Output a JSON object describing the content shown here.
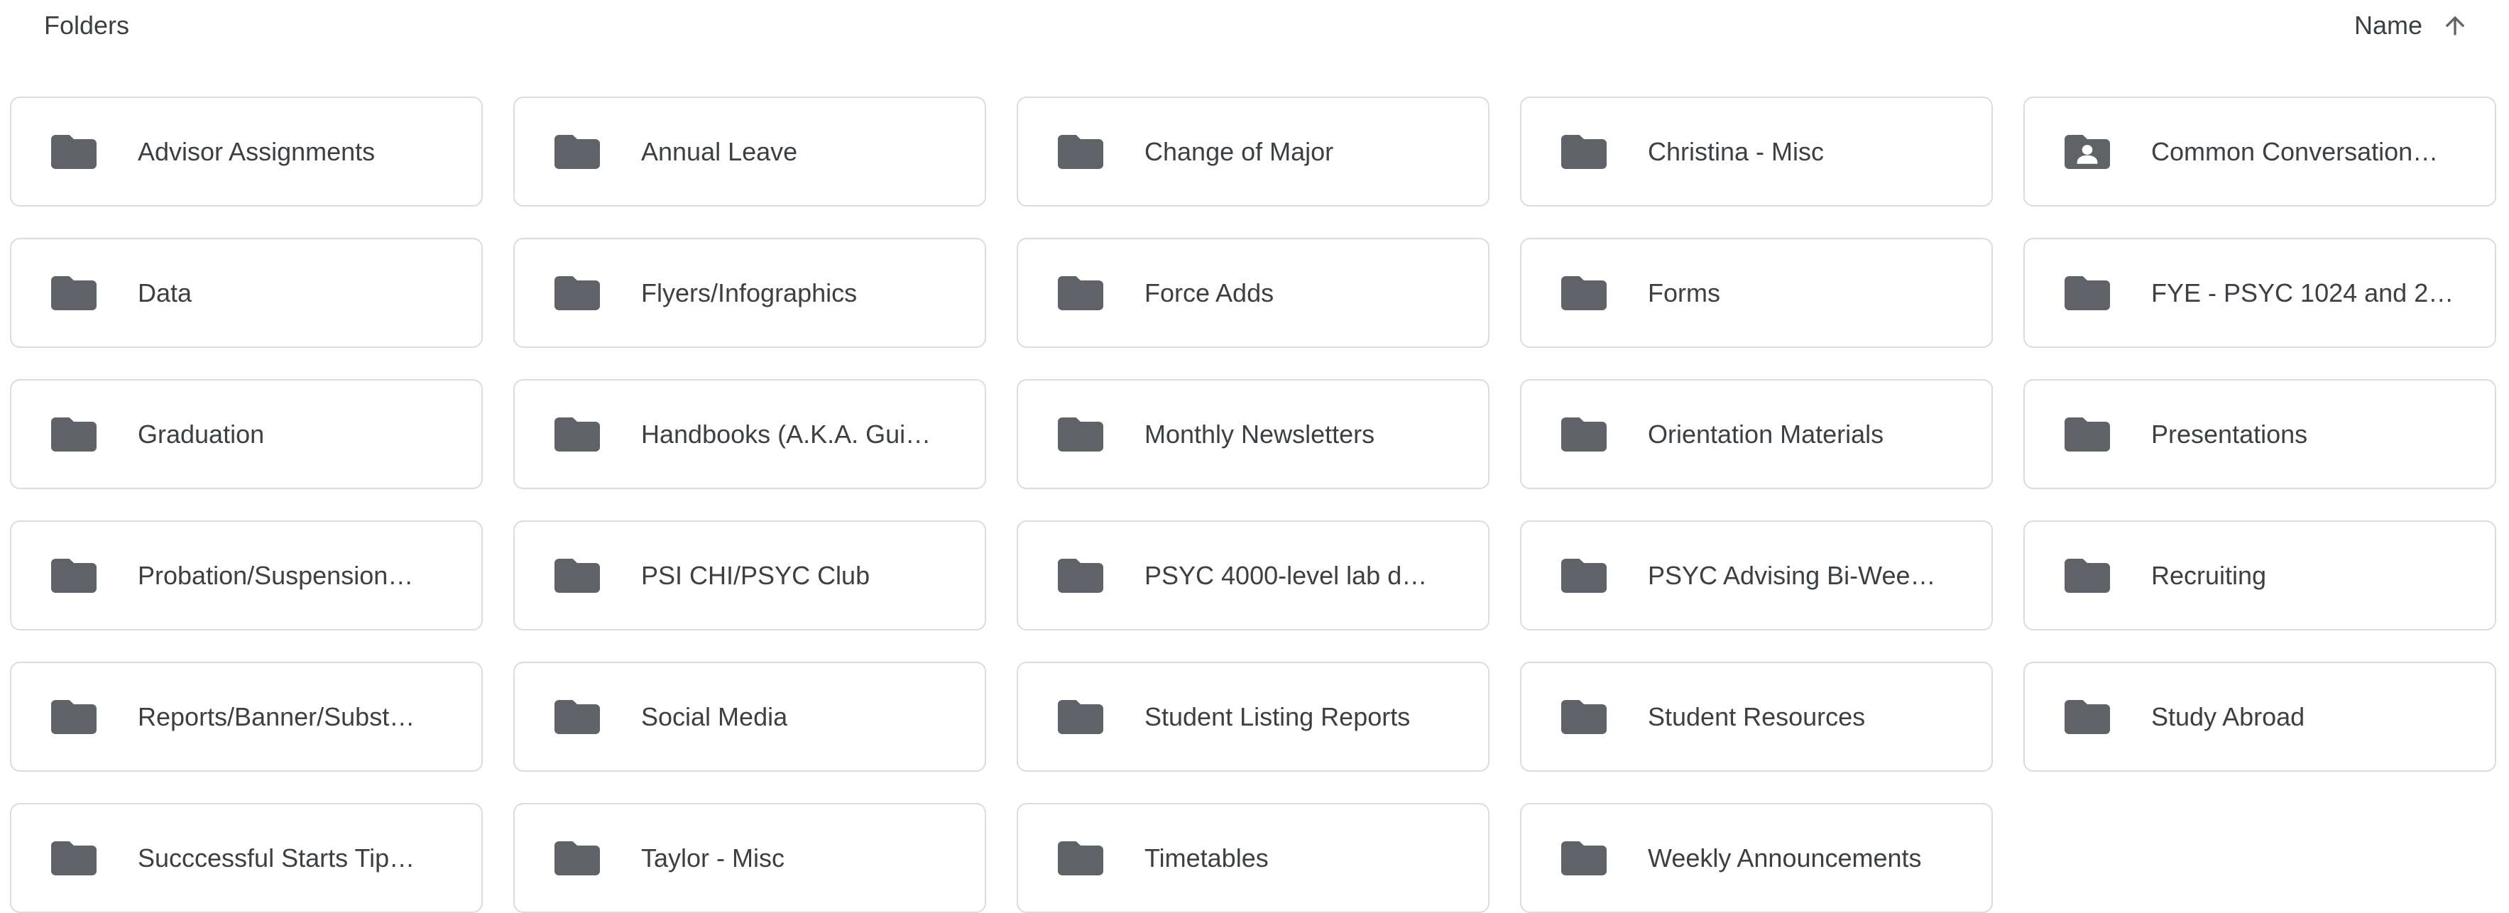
{
  "header": {
    "section_title": "Folders",
    "sort_label": "Name",
    "sort_direction_icon": "arrow-up-icon"
  },
  "folders": [
    {
      "name": "Advisor Assignments",
      "icon": "folder-icon"
    },
    {
      "name": "Annual Leave",
      "icon": "folder-icon"
    },
    {
      "name": "Change of Major",
      "icon": "folder-icon"
    },
    {
      "name": "Christina - Misc",
      "icon": "folder-icon"
    },
    {
      "name": "Common Conversation…",
      "icon": "shared-folder-icon"
    },
    {
      "name": "Data",
      "icon": "folder-icon"
    },
    {
      "name": "Flyers/Infographics",
      "icon": "folder-icon"
    },
    {
      "name": "Force Adds",
      "icon": "folder-icon"
    },
    {
      "name": "Forms",
      "icon": "folder-icon"
    },
    {
      "name": "FYE - PSYC 1024 and 2…",
      "icon": "folder-icon"
    },
    {
      "name": "Graduation",
      "icon": "folder-icon"
    },
    {
      "name": "Handbooks (A.K.A. Gui…",
      "icon": "folder-icon"
    },
    {
      "name": "Monthly Newsletters",
      "icon": "folder-icon"
    },
    {
      "name": "Orientation Materials",
      "icon": "folder-icon"
    },
    {
      "name": "Presentations",
      "icon": "folder-icon"
    },
    {
      "name": "Probation/Suspension…",
      "icon": "folder-icon"
    },
    {
      "name": "PSI CHI/PSYC Club",
      "icon": "folder-icon"
    },
    {
      "name": "PSYC 4000-level lab d…",
      "icon": "folder-icon"
    },
    {
      "name": "PSYC Advising Bi-Wee…",
      "icon": "folder-icon"
    },
    {
      "name": "Recruiting",
      "icon": "folder-icon"
    },
    {
      "name": "Reports/Banner/Subst…",
      "icon": "folder-icon"
    },
    {
      "name": "Social Media",
      "icon": "folder-icon"
    },
    {
      "name": "Student Listing Reports",
      "icon": "folder-icon"
    },
    {
      "name": "Student Resources",
      "icon": "folder-icon"
    },
    {
      "name": "Study Abroad",
      "icon": "folder-icon"
    },
    {
      "name": "Succcessful Starts Tip…",
      "icon": "folder-icon"
    },
    {
      "name": "Taylor - Misc",
      "icon": "folder-icon"
    },
    {
      "name": "Timetables",
      "icon": "folder-icon"
    },
    {
      "name": "Weekly Announcements",
      "icon": "folder-icon"
    }
  ],
  "colors": {
    "folder_icon": "#5f6368",
    "text": "#3c4043",
    "card_border": "#dadce0"
  }
}
